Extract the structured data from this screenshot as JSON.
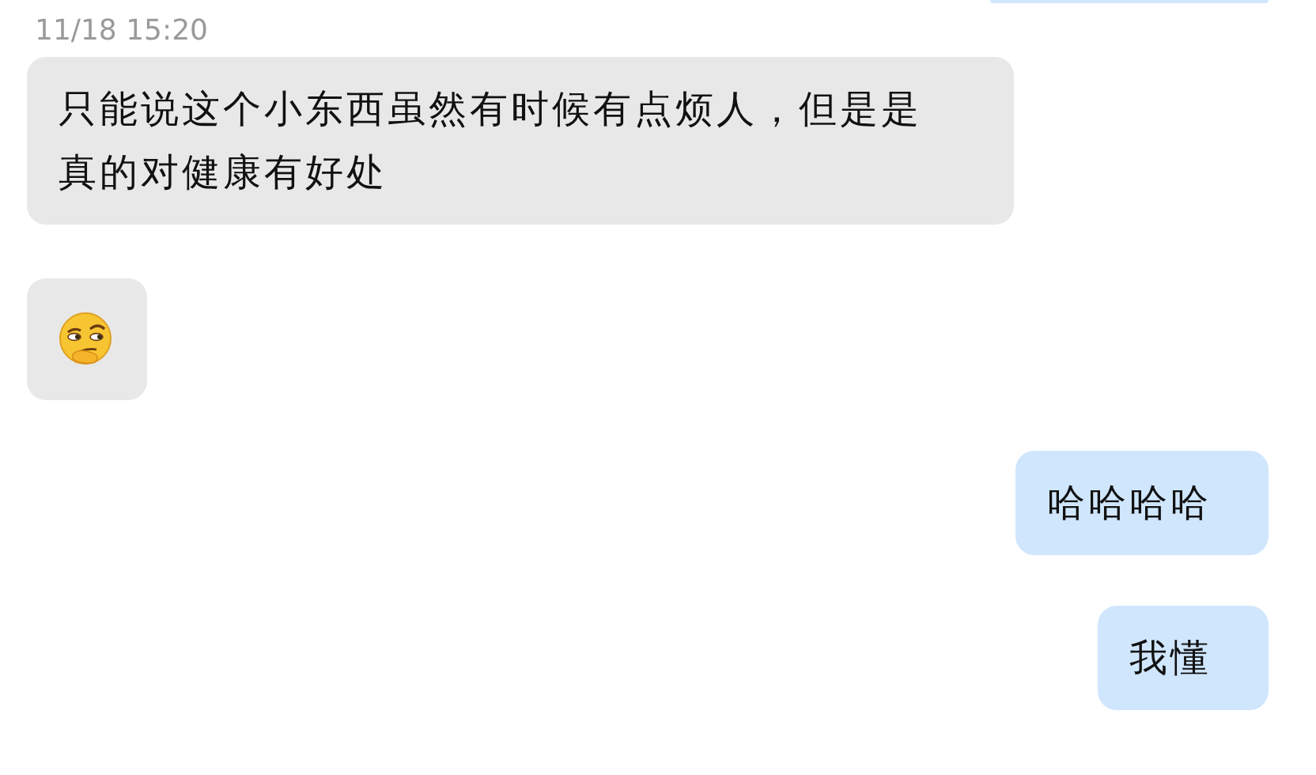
{
  "messages": [
    {
      "kind": "clipped",
      "outgoing": true
    },
    {
      "kind": "timestamp",
      "text": "11/18 15:20"
    },
    {
      "kind": "text",
      "outgoing": false,
      "text": "只能说这个小东西虽然有时候有点烦人，但是是真的对健康有好处"
    },
    {
      "kind": "emoji",
      "outgoing": false
    },
    {
      "kind": "text",
      "outgoing": true,
      "text": "哈哈哈哈"
    },
    {
      "kind": "text",
      "outgoing": true,
      "text": "我懂"
    }
  ]
}
